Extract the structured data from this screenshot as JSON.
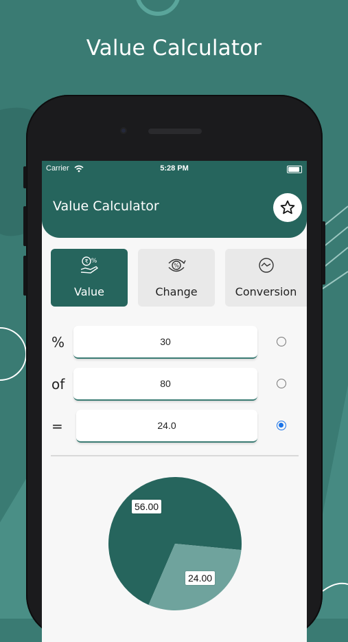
{
  "promo": {
    "title": "Value Calculator"
  },
  "status_bar": {
    "carrier": "Carrier",
    "time": "5:28 PM"
  },
  "header": {
    "title": "Value Calculator"
  },
  "tabs": [
    {
      "label": "Value",
      "icon": "money-percent-icon",
      "active": true
    },
    {
      "label": "Change",
      "icon": "percent-change-icon",
      "active": false
    },
    {
      "label": "Conversion",
      "icon": "conversion-icon",
      "active": false
    }
  ],
  "rows": [
    {
      "label": "%",
      "value": "30",
      "selected": false
    },
    {
      "label": "of",
      "value": "80",
      "selected": false
    },
    {
      "label": "=",
      "value": "24.0",
      "selected": true
    }
  ],
  "chart_data": {
    "type": "pie",
    "slices": [
      {
        "label": "56.00",
        "value": 56.0,
        "color": "#26655d"
      },
      {
        "label": "24.00",
        "value": 24.0,
        "color": "#6fa39d"
      }
    ]
  },
  "colors": {
    "primary": "#26655d",
    "background": "#3a7b73",
    "radio_selected": "#1a73e8"
  }
}
